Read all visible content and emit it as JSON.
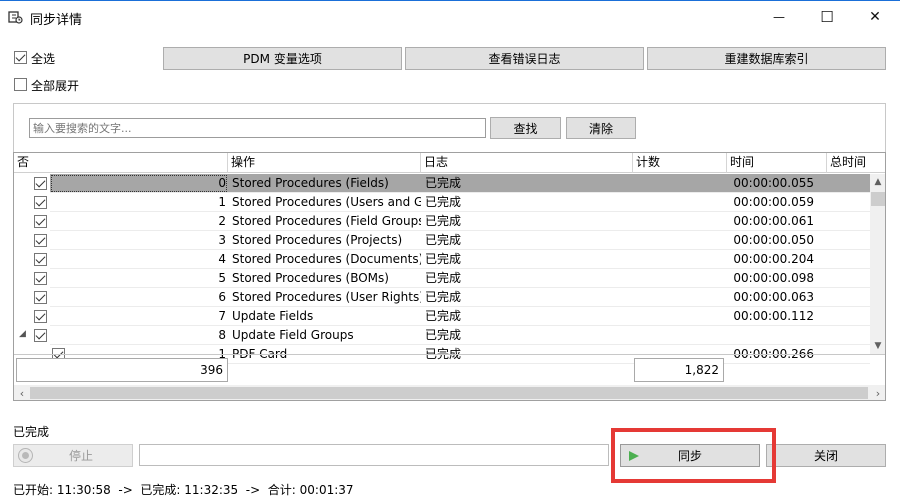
{
  "window": {
    "title": "同步详情",
    "minimize": "—",
    "maximize": "☐",
    "close": "✕"
  },
  "options": {
    "select_all": "全选",
    "expand_all": "全部展开"
  },
  "toolbar": {
    "pdm_options": "PDM 变量选项",
    "view_error_log": "查看错误日志",
    "rebuild_index": "重建数据库索引"
  },
  "search": {
    "placeholder": "输入要搜索的文字...",
    "find": "查找",
    "clear": "清除"
  },
  "grid": {
    "columns": [
      "否",
      "操作",
      "日志",
      "计数",
      "时间",
      "总时间"
    ],
    "rows": [
      {
        "num": "0",
        "op": "Stored Procedures (Fields)",
        "log": "已完成",
        "count": "",
        "time": "00:00:00.055",
        "total": ""
      },
      {
        "num": "1",
        "op": "Stored Procedures (Users and G...",
        "log": "已完成",
        "count": "",
        "time": "00:00:00.059",
        "total": ""
      },
      {
        "num": "2",
        "op": "Stored Procedures (Field Groups)",
        "log": "已完成",
        "count": "",
        "time": "00:00:00.061",
        "total": ""
      },
      {
        "num": "3",
        "op": "Stored Procedures (Projects)",
        "log": "已完成",
        "count": "",
        "time": "00:00:00.050",
        "total": ""
      },
      {
        "num": "4",
        "op": "Stored Procedures (Documents)",
        "log": "已完成",
        "count": "",
        "time": "00:00:00.204",
        "total": ""
      },
      {
        "num": "5",
        "op": "Stored Procedures (BOMs)",
        "log": "已完成",
        "count": "",
        "time": "00:00:00.098",
        "total": ""
      },
      {
        "num": "6",
        "op": "Stored Procedures (User Rights)",
        "log": "已完成",
        "count": "",
        "time": "00:00:00.063",
        "total": ""
      },
      {
        "num": "7",
        "op": "Update Fields",
        "log": "已完成",
        "count": "",
        "time": "00:00:00.112",
        "total": ""
      },
      {
        "num": "8",
        "op": "Update Field Groups",
        "log": "已完成",
        "count": "",
        "time": "",
        "total": ""
      },
      {
        "num": "1",
        "op": "PDF Card",
        "log": "已完成",
        "count": "",
        "time": "00:00:00.266",
        "total": ""
      }
    ],
    "footer_number": "396",
    "footer_count": "1,822"
  },
  "progress": {
    "status_label": "已完成",
    "stop": "停止",
    "sync": "同步",
    "close": "关闭"
  },
  "status_bar": {
    "text": "已开始: 11:30:58  ->  已完成: 11:32:35  ->  合计: 00:01:37"
  },
  "colors": {
    "highlight": "#e53935",
    "selected_row": "#a6a6a6",
    "play_icon": "#4caf50"
  }
}
